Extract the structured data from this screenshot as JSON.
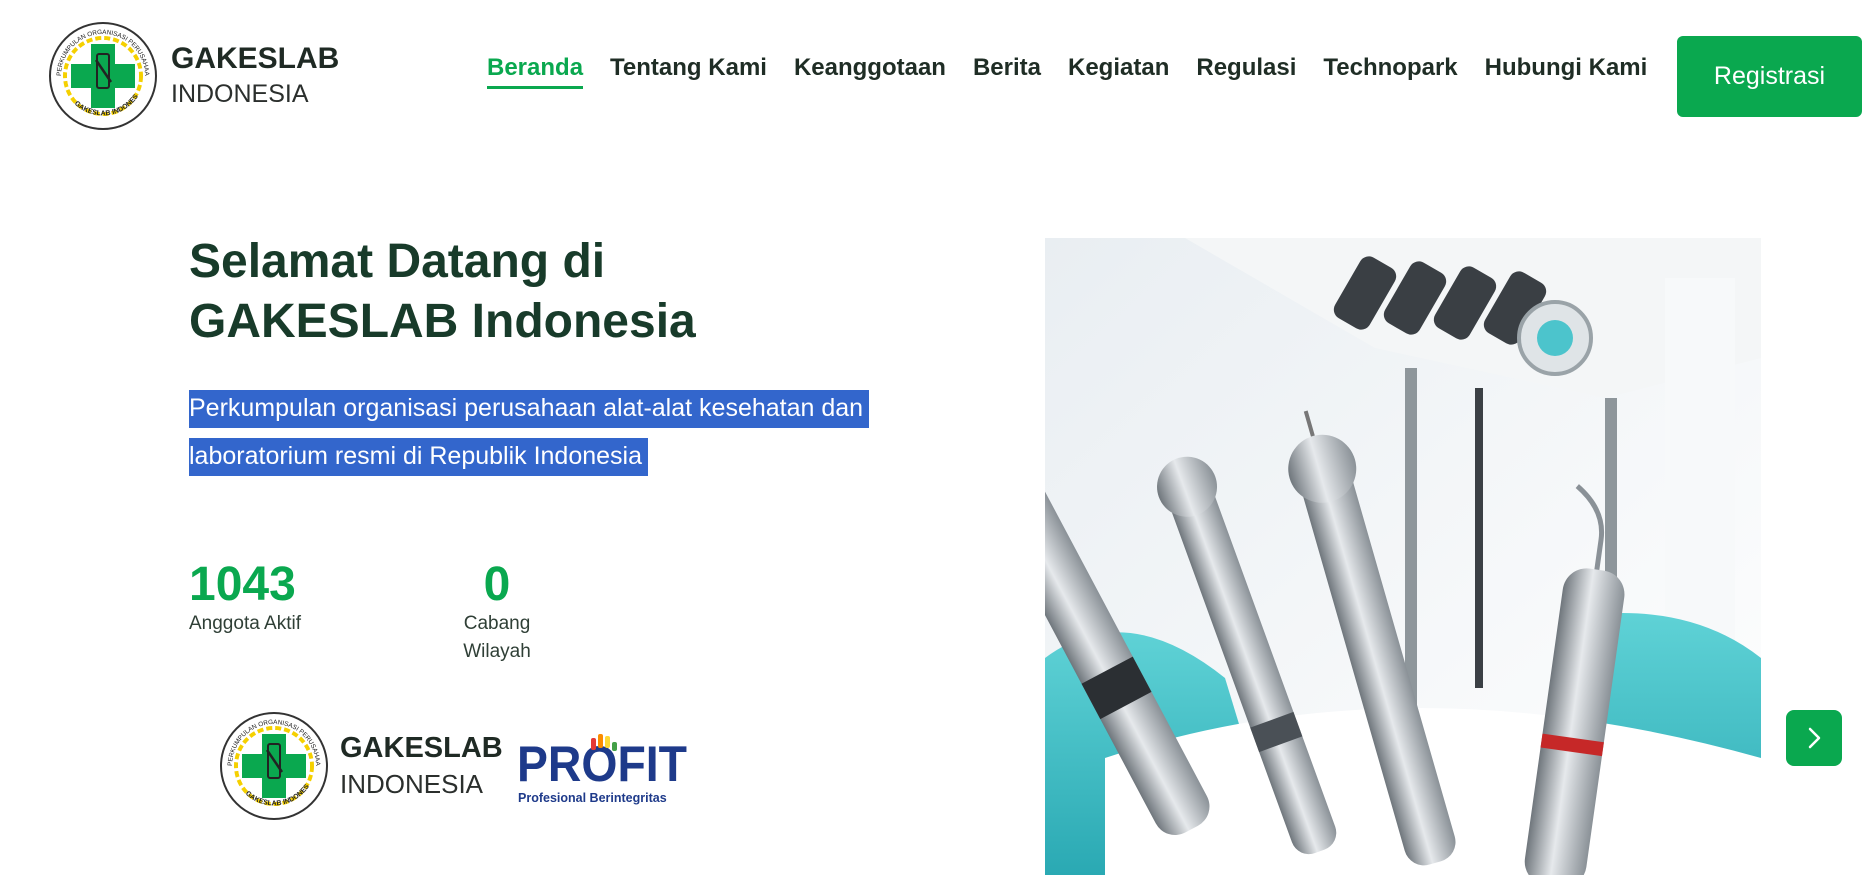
{
  "header": {
    "logo": {
      "name": "GAKESLAB",
      "sub": "INDONESIA",
      "seal_text": "PERKUMPULAN ORGANISASI PERUSAHAAN ALAT-ALAT KESEHATAN DAN LABORATORIUM",
      "seal_bottom": "GAKESLAB INDONESIA"
    },
    "nav": [
      {
        "label": "Beranda",
        "active": true
      },
      {
        "label": "Tentang Kami"
      },
      {
        "label": "Keanggotaan"
      },
      {
        "label": "Berita"
      },
      {
        "label": "Kegiatan"
      },
      {
        "label": "Regulasi"
      },
      {
        "label": "Technopark"
      },
      {
        "label": "Hubungi Kami"
      }
    ],
    "register_label": "Registrasi"
  },
  "hero": {
    "title_line1": "Selamat Datang di",
    "title_line2": "GAKESLAB Indonesia",
    "description_line1": "Perkumpulan organisasi perusahaan alat-alat kesehatan dan",
    "description_line2": "laboratorium resmi di Republik Indonesia",
    "stats": [
      {
        "value": "1043",
        "label": "Anggota Aktif"
      },
      {
        "value": "0",
        "label": "Cabang Wilayah"
      }
    ],
    "partner": {
      "name": "GAKESLAB",
      "sub": "INDONESIA",
      "profit": "PROFIT",
      "profit_tagline": "Profesional Berintegritas"
    },
    "image_icon": "dental-instruments-photo",
    "next_icon": "chevron-right-icon"
  },
  "colors": {
    "accent": "#0aa84f",
    "title": "#183b2a",
    "selection": "#3366cc",
    "profit_blue": "#1e3a8a"
  }
}
